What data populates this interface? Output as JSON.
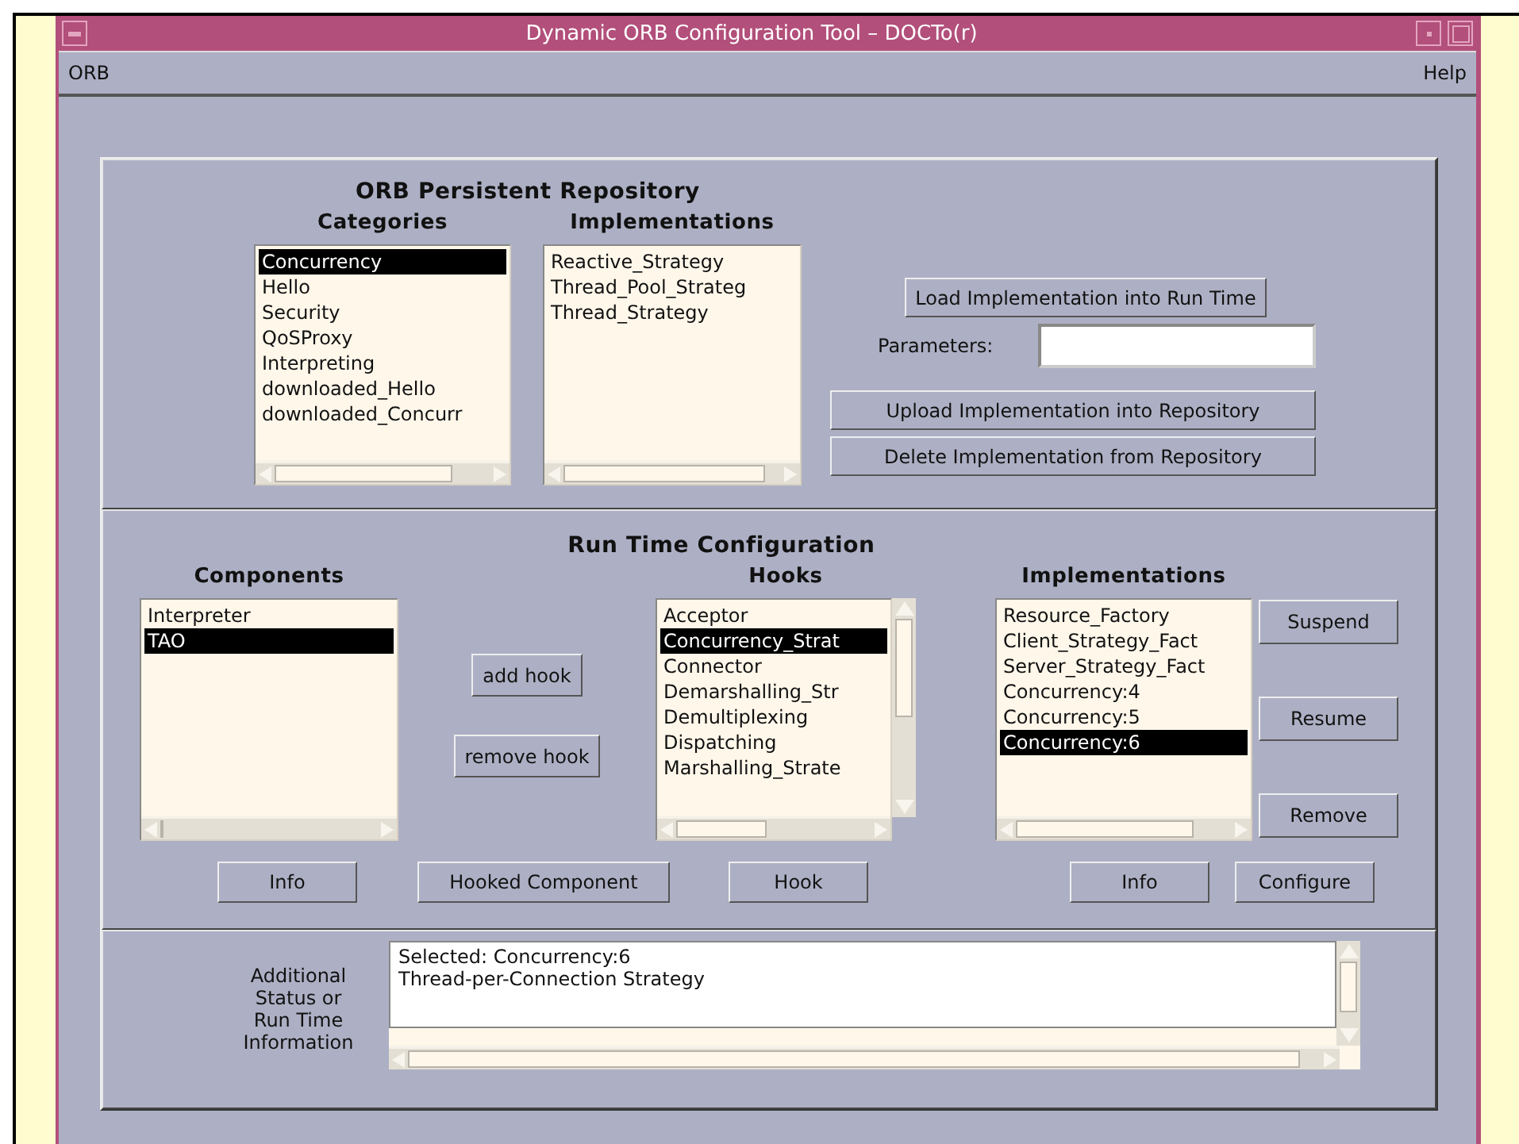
{
  "window": {
    "title": "Dynamic ORB Configuration Tool – DOCTo(r)"
  },
  "menu": [
    {
      "label": "ORB"
    },
    {
      "label": "Help"
    }
  ],
  "repository": {
    "title": "ORB Persistent Repository",
    "categories": {
      "header": "Categories",
      "items": [
        {
          "label": "Concurrency",
          "selected": true
        },
        {
          "label": "Hello",
          "selected": false
        },
        {
          "label": "Security",
          "selected": false
        },
        {
          "label": "QoSProxy",
          "selected": false
        },
        {
          "label": "Interpreting",
          "selected": false
        },
        {
          "label": "downloaded_Hello",
          "selected": false
        },
        {
          "label": "downloaded_Concurr",
          "selected": false
        }
      ]
    },
    "implementations": {
      "header": "Implementations",
      "items": [
        {
          "label": "Reactive_Strategy",
          "selected": false
        },
        {
          "label": "Thread_Pool_Strateg",
          "selected": false
        },
        {
          "label": "Thread_Strategy",
          "selected": false
        }
      ]
    },
    "load_button": "Load Implementation into Run Time",
    "parameters": {
      "label": "Parameters:"
    },
    "upload_button": "Upload Implementation into Repository",
    "delete_button": "Delete Implementation from Repository"
  },
  "runtime": {
    "title": "Run Time Configuration",
    "components": {
      "header": "Components",
      "items": [
        {
          "label": "Interpreter",
          "selected": false
        },
        {
          "label": "TAO",
          "selected": true
        }
      ]
    },
    "add_hook": "add hook",
    "remove_hook": "remove hook",
    "hooks": {
      "header": "Hooks",
      "items": [
        {
          "label": "Acceptor",
          "selected": false
        },
        {
          "label": "Concurrency_Strat",
          "selected": true
        },
        {
          "label": "Connector",
          "selected": false
        },
        {
          "label": "Demarshalling_Str",
          "selected": false
        },
        {
          "label": "Demultiplexing",
          "selected": false
        },
        {
          "label": "Dispatching",
          "selected": false
        },
        {
          "label": "Marshalling_Strate",
          "selected": false
        }
      ]
    },
    "implementations": {
      "header": "Implementations",
      "items": [
        {
          "label": "Resource_Factory",
          "selected": false
        },
        {
          "label": "Client_Strategy_Fact",
          "selected": false
        },
        {
          "label": "Server_Strategy_Fact",
          "selected": false
        },
        {
          "label": "Concurrency:4",
          "selected": false
        },
        {
          "label": "Concurrency:5",
          "selected": false
        },
        {
          "label": "Concurrency:6",
          "selected": true
        }
      ]
    },
    "side_buttons": [
      "Suspend",
      "Resume",
      "Remove"
    ],
    "bottom_buttons": [
      "Info",
      "Hooked Component",
      "Hook",
      "Info",
      "Configure"
    ]
  },
  "status": {
    "label_lines": [
      "Additional",
      "Status or",
      "Run Time",
      "Information"
    ],
    "lines": [
      "Selected: Concurrency:6",
      "Thread-per-Connection Strategy"
    ]
  }
}
